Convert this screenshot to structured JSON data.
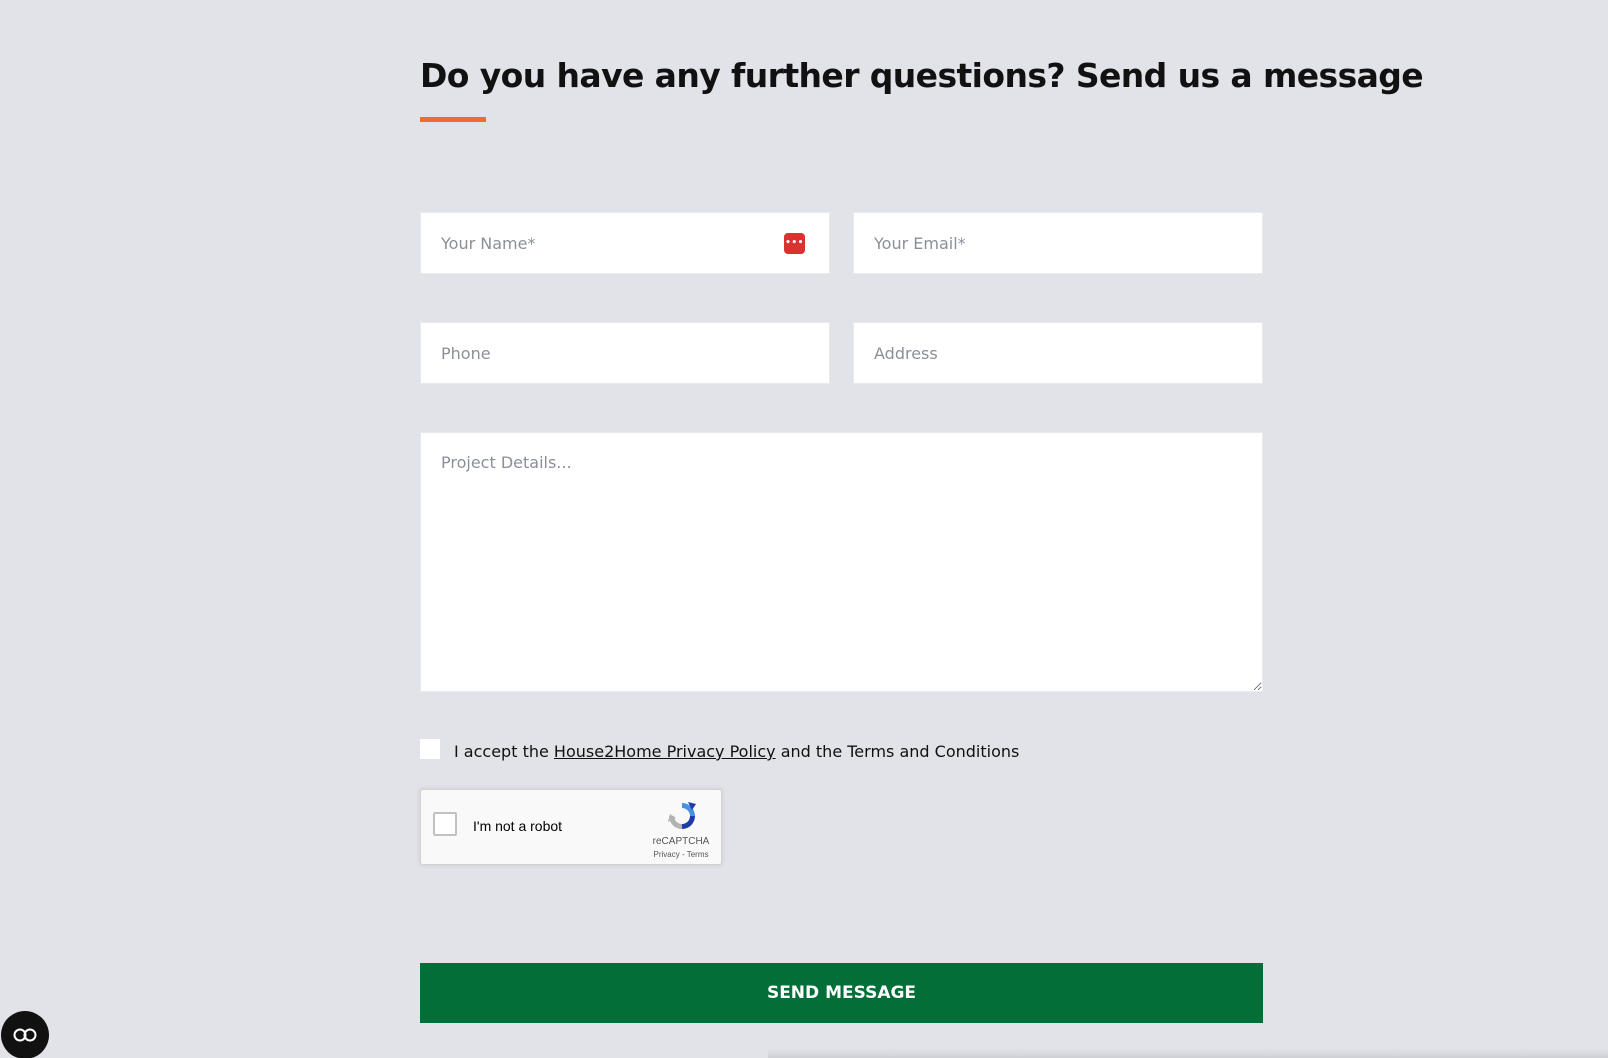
{
  "heading": "Do you have any further questions? Send us a message",
  "colors": {
    "accent": "#f26a2e",
    "button": "#026e38",
    "background": "#e2e3e8"
  },
  "form": {
    "name_placeholder": "Your Name*",
    "email_placeholder": "Your Email*",
    "phone_placeholder": "Phone",
    "address_placeholder": "Address",
    "details_placeholder": "Project Details...",
    "password_manager_icon": "•••"
  },
  "consent": {
    "prefix": "I accept the",
    "link_text": "House2Home Privacy Policy",
    "suffix": "and the Terms and Conditions"
  },
  "recaptcha": {
    "label": "I'm not a robot",
    "brand": "reCAPTCHA",
    "links": "Privacy - Terms"
  },
  "submit_label": "SEND MESSAGE",
  "icons": {
    "password_manager": "password-manager-icon",
    "accessibility": "accessibility-toggle-icon",
    "recaptcha": "recaptcha-logo-icon"
  }
}
